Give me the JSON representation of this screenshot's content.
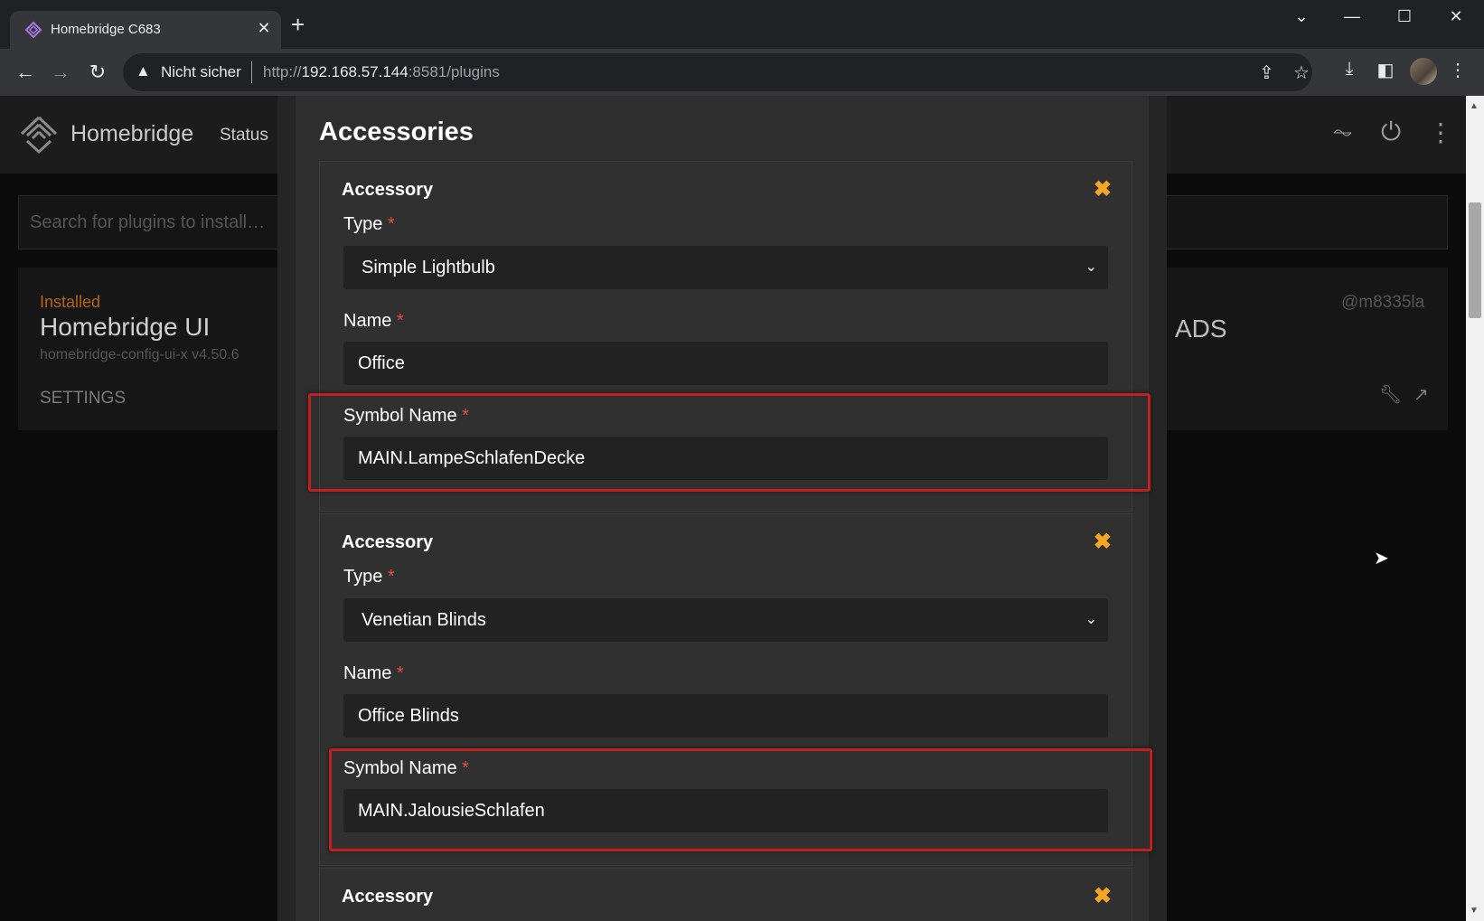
{
  "browser": {
    "tab_title": "Homebridge C683",
    "tab_close": "✕",
    "new_tab": "+",
    "window_controls": {
      "dropdown": "⌄",
      "minimize": "—",
      "maximize": "☐",
      "close": "✕"
    },
    "security_label": "Nicht sicher",
    "url_scheme": "http://",
    "url_host": "192.168.57.144",
    "url_rest": ":8581/plugins"
  },
  "app": {
    "title": "Homebridge",
    "nav_status": "Status",
    "search_placeholder": "Search for plugins to install…",
    "plugin": {
      "installed_label": "Installed",
      "name": "Homebridge UI",
      "package": "homebridge-config-ui-x v4.50.6",
      "settings_label": "SETTINGS",
      "author": "@m8335la",
      "second_name_fragment": "ADS"
    }
  },
  "modal": {
    "heading": "Accessories",
    "accessories": [
      {
        "title": "Accessory",
        "type_label": "Type",
        "type_value": "Simple Lightbulb",
        "name_label": "Name",
        "name_value": "Office",
        "symbol_label": "Symbol Name",
        "symbol_value": "MAIN.LampeSchlafenDecke"
      },
      {
        "title": "Accessory",
        "type_label": "Type",
        "type_value": "Venetian Blinds",
        "name_label": "Name",
        "name_value": "Office Blinds",
        "symbol_label": "Symbol Name",
        "symbol_value": "MAIN.JalousieSchlafen"
      },
      {
        "title": "Accessory"
      }
    ],
    "required_marker": "*",
    "close_glyph": "✖"
  },
  "colors": {
    "accent_close": "#f5a623",
    "required": "#e74c3c",
    "highlight": "#c0201e"
  }
}
